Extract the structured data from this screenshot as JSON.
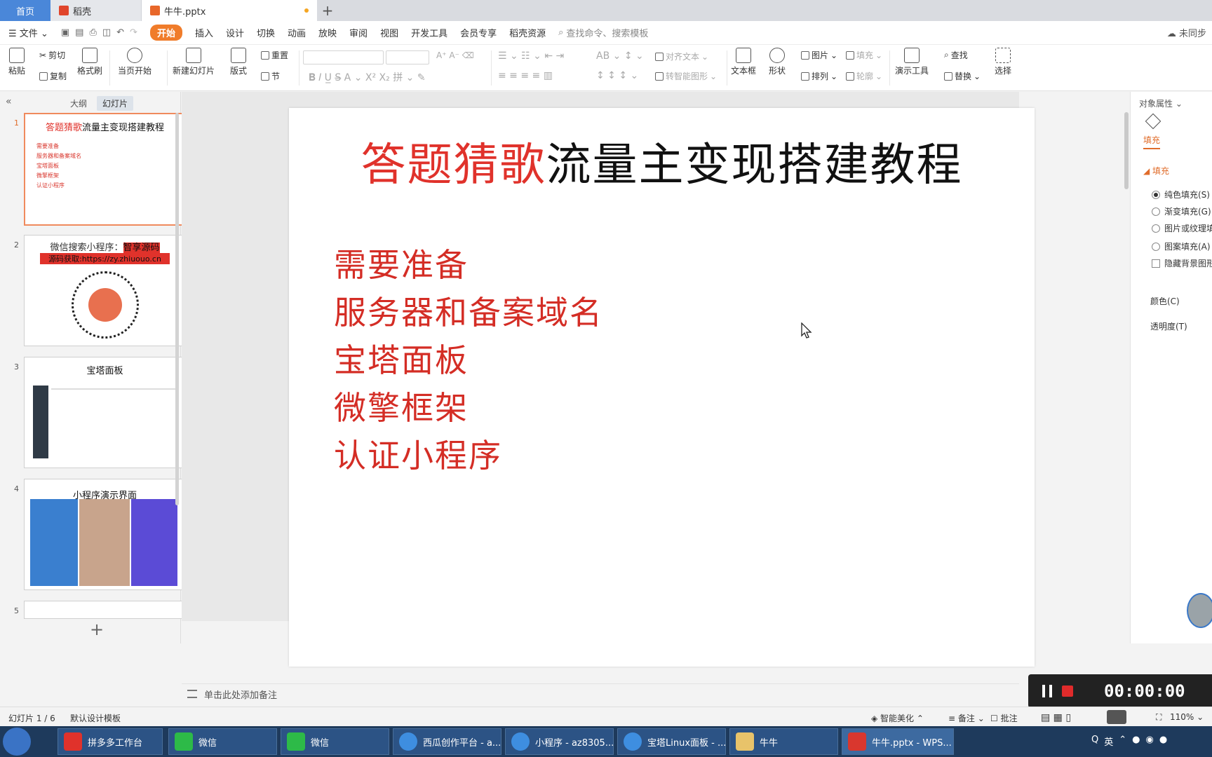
{
  "tabs": {
    "home": "首页",
    "daoke": "稻壳",
    "doc": "牛牛.pptx"
  },
  "menubar": {
    "file": "文件",
    "items": [
      "开始",
      "插入",
      "设计",
      "切换",
      "动画",
      "放映",
      "审阅",
      "视图",
      "开发工具",
      "会员专享",
      "稻壳资源"
    ],
    "search_placeholder": "查找命令、搜索模板",
    "cloud": "未同步"
  },
  "ribbon": {
    "paste": "粘贴",
    "cut": "剪切",
    "copy": "复制",
    "format_painter": "格式刷",
    "from_current": "当页开始",
    "new_slide": "新建幻灯片",
    "layout": "版式",
    "reset": "重置",
    "section": "节",
    "align_text": "对齐文本",
    "smart_shape": "转智能图形",
    "textbox": "文本框",
    "shape": "形状",
    "picture": "图片",
    "arrange": "排列",
    "fill": "填充",
    "outline": "轮廓",
    "presentation_tools": "演示工具",
    "find": "查找",
    "replace": "替换",
    "select": "选择"
  },
  "left_panel": {
    "tab_outline": "大纲",
    "tab_slides": "幻灯片",
    "thumbs": [
      {
        "num": "1",
        "title_red": "答题猜歌",
        "title_black": "流量主变现搭建教程",
        "items": [
          "需要准备",
          "服务器和备案域名",
          "宝塔面板",
          "微擎框架",
          "认证小程序"
        ]
      },
      {
        "num": "2",
        "line1": "微信搜索小程序：",
        "line1_red": "智享源码",
        "line2": "源码获取:https://zy.zhiuouo.cn"
      },
      {
        "num": "3",
        "title": "宝塔面板"
      },
      {
        "num": "4",
        "title": "小程序演示界面"
      },
      {
        "num": "5"
      }
    ]
  },
  "slide": {
    "title_red": "答题猜歌",
    "title_black": "流量主变现搭建教程",
    "items": [
      "需要准备",
      "服务器和备案域名",
      "宝塔面板",
      "微擎框架",
      "认证小程序"
    ]
  },
  "notes_placeholder": "单击此处添加备注",
  "right_panel": {
    "title": "对象属性",
    "tab_fill": "填充",
    "section_fill": "填充",
    "options": [
      "纯色填充(S)",
      "渐变填充(G)",
      "图片或纹理填",
      "图案填充(A)"
    ],
    "hide_bg": "隐藏背景图形",
    "color": "颜色(C)",
    "transparency": "透明度(T)"
  },
  "recorder": {
    "time": "00:00:00"
  },
  "status": {
    "slide_count": "幻灯片 1 / 6",
    "template": "默认设计模板",
    "beautify": "智能美化",
    "notes": "备注",
    "comments": "批注",
    "zoom": "110%"
  },
  "taskbar": {
    "items": [
      "拼多多工作台",
      "微信",
      "微信",
      "西瓜创作平台 - a...",
      "小程序 - az8305...",
      "宝塔Linux面板 - ...",
      "牛牛",
      "牛牛.pptx - WPS..."
    ],
    "ime": "英"
  },
  "colors": {
    "accent": "#f07c2a",
    "slide_red": "#e0322b",
    "taskbar": "#1e3a5c"
  }
}
